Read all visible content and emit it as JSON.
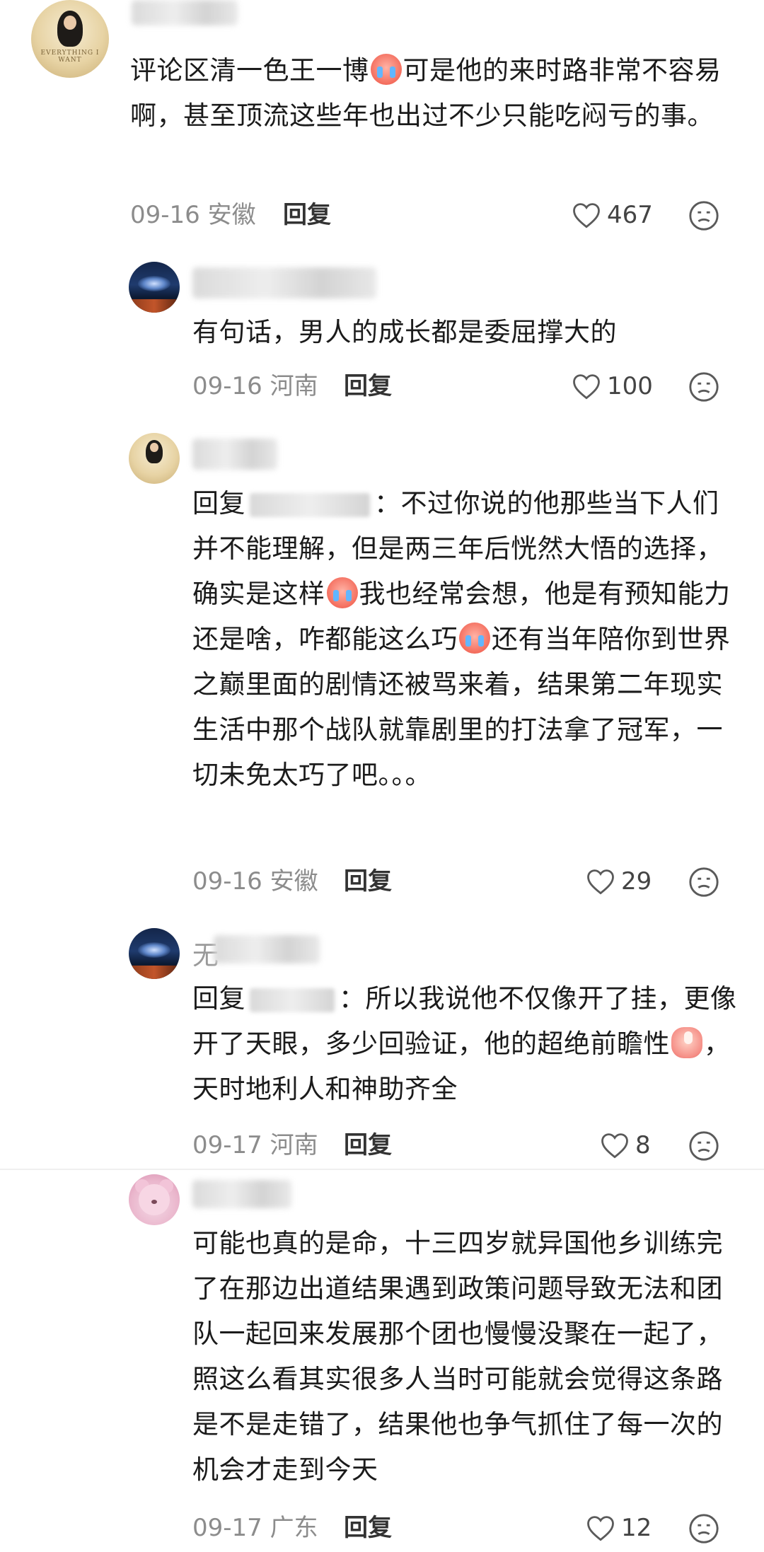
{
  "comments": [
    {
      "name_visible": "",
      "text": "评论区清一色王一博",
      "text_after_emoji": "可是他的来时路非常不容易啊，甚至顶流这些年也出过不少只能吃闷亏的事。",
      "avatar_text": "EVERYTHING I WANT",
      "date": "09-16",
      "location": "安徽",
      "reply_label": "回复",
      "likes": "467",
      "avatar_icon": "gold-portrait-avatar"
    },
    {
      "name_visible": "",
      "text": "有句话，男人的成长都是委屈撑大的",
      "date": "09-16",
      "location": "河南",
      "reply_label": "回复",
      "likes": "100",
      "avatar_icon": "night-landscape-avatar"
    },
    {
      "name_visible": "",
      "reply_prefix": "回复",
      "text_1": "：不过你说的他那些当下人们并不能理解，但是两三年后恍然大悟的选择，确实是这样",
      "text_2": "我也经常会想，他是有预知能力还是啥，咋都能这么巧",
      "text_3": "还有当年陪你到世界之巅里面的剧情还被骂来着，结果第二年现实生活中那个战队就靠剧里的打法拿了冠军，一切未免太巧了吧。。。",
      "date": "09-16",
      "location": "安徽",
      "reply_label": "回复",
      "likes": "29",
      "avatar_icon": "gold-portrait-avatar"
    },
    {
      "name_visible": "无",
      "reply_prefix": "回复",
      "text_1": "：所以我说他不仅像开了挂，更像开了天眼，多少回验证，他的超绝前瞻性",
      "text_2": "，天时地利人和神助齐全",
      "date": "09-17",
      "location": "河南",
      "reply_label": "回复",
      "likes": "8",
      "avatar_icon": "night-landscape-avatar"
    },
    {
      "name_visible": "",
      "text": "可能也真的是命，十三四岁就异国他乡训练完了在那边出道结果遇到政策问题导致无法和团队一起回来发展那个团也慢慢没聚在一起了，照这么看其实很多人当时可能就会觉得这条路是不是走错了，结果他也争气抓住了每一次的机会才走到今天",
      "date": "09-17",
      "location": "广东",
      "reply_label": "回复",
      "likes": "12",
      "avatar_icon": "pink-bear-avatar"
    }
  ],
  "colors": {
    "text": "#1b1b1b",
    "meta": "#8c8c8c",
    "icon": "#5a5a5a",
    "divider": "#efefef"
  }
}
